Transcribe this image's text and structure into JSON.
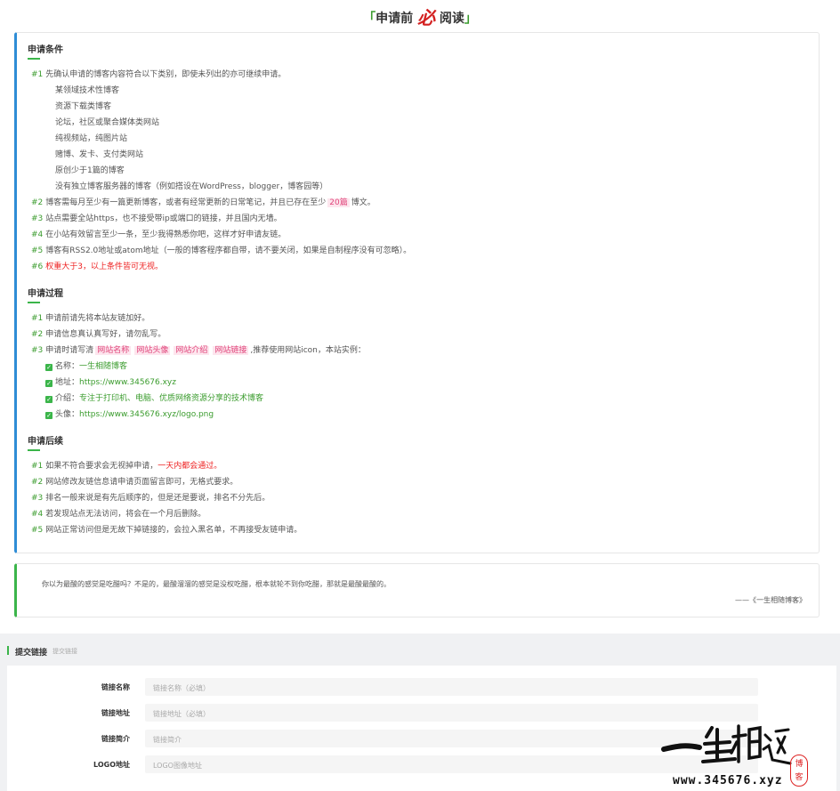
{
  "header": {
    "bracket_left": "「",
    "title_pre": "申请前",
    "title_em": "必",
    "title_post": "阅读",
    "bracket_right": "」"
  },
  "conditions": {
    "title": "申请条件",
    "items": [
      {
        "num": "#1",
        "text": "先确认申请的博客内容符合以下类别，即使未列出的亦可继续申请。"
      },
      {
        "num": "#2",
        "text_pre": "博客需每月至少有一篇更新博客，或者有经常更新的日常笔记，并且已存在至少",
        "badge": "20篇",
        "text_post": "博文。"
      },
      {
        "num": "#3",
        "text": "站点需要全站https，也不接受带ip或端口的链接，并且国内无墙。"
      },
      {
        "num": "#4",
        "text": "在小站有效留言至少一条，至少我得熟悉你吧，这样才好申请友链。"
      },
      {
        "num": "#5",
        "text": "博客有RSS2.0地址或atom地址（一般的博客程序都自带，请不要关闭，如果是自制程序没有可忽略）。"
      },
      {
        "num": "#6",
        "text": "权重大于3，以上条件皆可无视。"
      }
    ],
    "sub_items": [
      "某领域技术性博客",
      "资源下载类博客",
      "论坛，社区或聚合媒体类网站",
      "纯视频站，纯图片站",
      "赌博、发卡、支付类网站",
      "原创少于1篇的博客",
      "没有独立博客服务器的博客（例如搭设在WordPress，blogger，博客园等）"
    ]
  },
  "process": {
    "title": "申请过程",
    "items": [
      {
        "num": "#1",
        "text": "申请前请先将本站友链加好。"
      },
      {
        "num": "#2",
        "text": "申请信息真认真写好，请勿乱写。"
      },
      {
        "num": "#3",
        "text_pre": "申请时请写清",
        "tags": [
          "网站名称",
          "网站头像",
          "网站介绍",
          "网站链接"
        ],
        "text_post": ",推荐使用网站icon，本站实例："
      }
    ],
    "examples": [
      {
        "label": "名称：",
        "value": "一生相随博客"
      },
      {
        "label": "地址：",
        "value": "https://www.345676.xyz"
      },
      {
        "label": "介绍：",
        "value": "专注于打印机、电脑、优质网络资源分享的技术博客"
      },
      {
        "label": "头像：",
        "value": "https://www.345676.xyz/logo.png"
      }
    ]
  },
  "after": {
    "title": "申请后续",
    "items": [
      {
        "num": "#1",
        "text_pre": "如果不符合要求会无视掉申请，",
        "text_red": "一天内都会通过。"
      },
      {
        "num": "#2",
        "text": "网站修改友链信息请申请页面留言即可，无格式要求。"
      },
      {
        "num": "#3",
        "text": "排名一般来说是有先后顺序的，但是还是要说，排名不分先后。"
      },
      {
        "num": "#4",
        "text": "若发现站点无法访问，将会在一个月后删除。"
      },
      {
        "num": "#5",
        "text": "网站正常访问但是无故下掉链接的，会拉入黑名单，不再接受友链申请。"
      }
    ]
  },
  "quote": {
    "text": "你以为最酸的感觉是吃醋吗？不是的，最酸溜溜的感觉是没权吃醋，根本就轮不到你吃醋，那就是最酸最酸的。",
    "author": "——《一生相随博客》"
  },
  "form": {
    "title": "提交链接",
    "subtitle": "提交链接",
    "fields": [
      {
        "label": "链接名称",
        "placeholder": "链接名称（必填）"
      },
      {
        "label": "链接地址",
        "placeholder": "链接地址（必填）"
      },
      {
        "label": "链接简介",
        "placeholder": "链接简介"
      },
      {
        "label": "LOGO地址",
        "placeholder": "LOGO图像地址"
      }
    ]
  },
  "watermark": {
    "url": "www.345676.xyz",
    "calligraphy": "一生相随",
    "stamp": "博客"
  },
  "colors": {
    "accent_green": "#3bb54a",
    "accent_blue": "#2e8dd6",
    "warning_red": "#e22222",
    "tag_pink": "#e0457b"
  },
  "icons": {
    "example_check": "checkbox-checked-icon"
  }
}
